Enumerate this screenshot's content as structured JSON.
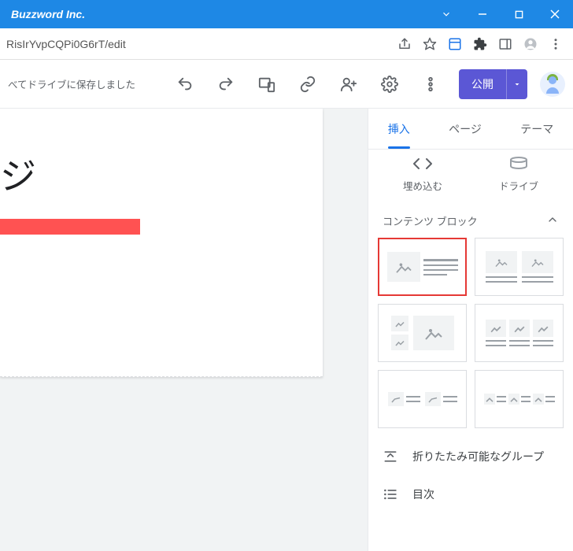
{
  "window": {
    "title": "Buzzword Inc."
  },
  "url": "RisIrYvpCQPi0G6rT/edit",
  "toolbar": {
    "status": "べてドライブに保存しました",
    "publish_label": "公開"
  },
  "canvas": {
    "page_title_fragment": "ジ"
  },
  "side_panel": {
    "tabs": {
      "insert": "挿入",
      "page": "ページ",
      "theme": "テーマ"
    },
    "quick": {
      "embed": "埋め込む",
      "drive": "ドライブ"
    },
    "section_blocks": "コンテンツ ブロック",
    "items": {
      "collapsible_group": "折りたたみ可能なグループ",
      "toc": "目次"
    }
  }
}
